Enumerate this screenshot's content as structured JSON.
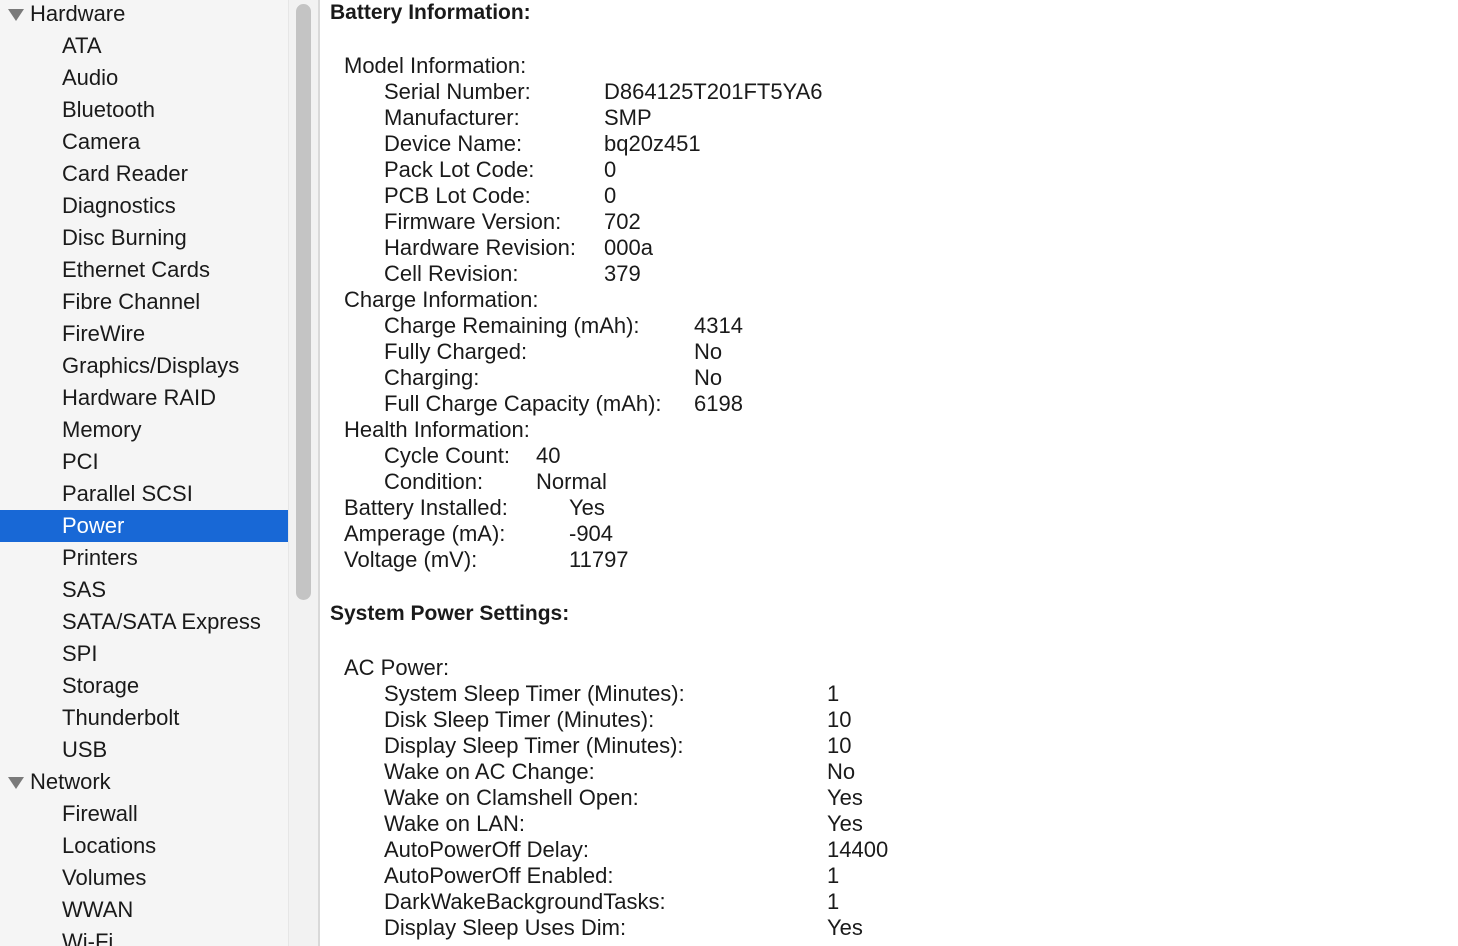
{
  "sidebar": {
    "items": [
      {
        "label": "Hardware",
        "type": "group"
      },
      {
        "label": "ATA",
        "type": "child"
      },
      {
        "label": "Audio",
        "type": "child"
      },
      {
        "label": "Bluetooth",
        "type": "child"
      },
      {
        "label": "Camera",
        "type": "child"
      },
      {
        "label": "Card Reader",
        "type": "child"
      },
      {
        "label": "Diagnostics",
        "type": "child"
      },
      {
        "label": "Disc Burning",
        "type": "child"
      },
      {
        "label": "Ethernet Cards",
        "type": "child"
      },
      {
        "label": "Fibre Channel",
        "type": "child"
      },
      {
        "label": "FireWire",
        "type": "child"
      },
      {
        "label": "Graphics/Displays",
        "type": "child"
      },
      {
        "label": "Hardware RAID",
        "type": "child"
      },
      {
        "label": "Memory",
        "type": "child"
      },
      {
        "label": "PCI",
        "type": "child"
      },
      {
        "label": "Parallel SCSI",
        "type": "child"
      },
      {
        "label": "Power",
        "type": "child",
        "selected": true
      },
      {
        "label": "Printers",
        "type": "child"
      },
      {
        "label": "SAS",
        "type": "child"
      },
      {
        "label": "SATA/SATA Express",
        "type": "child"
      },
      {
        "label": "SPI",
        "type": "child"
      },
      {
        "label": "Storage",
        "type": "child"
      },
      {
        "label": "Thunderbolt",
        "type": "child"
      },
      {
        "label": "USB",
        "type": "child"
      },
      {
        "label": "Network",
        "type": "group"
      },
      {
        "label": "Firewall",
        "type": "child"
      },
      {
        "label": "Locations",
        "type": "child"
      },
      {
        "label": "Volumes",
        "type": "child"
      },
      {
        "label": "WWAN",
        "type": "child"
      },
      {
        "label": "Wi-Fi",
        "type": "child"
      }
    ],
    "selected_color": "#1868d6",
    "disclosure_icon": "triangle-down-icon"
  },
  "battery": {
    "title": "Battery Information:",
    "model": {
      "heading": "Model Information:",
      "rows": [
        {
          "label": "Serial Number:",
          "value": "D864125T201FT5YA6"
        },
        {
          "label": "Manufacturer:",
          "value": "SMP"
        },
        {
          "label": "Device Name:",
          "value": "bq20z451"
        },
        {
          "label": "Pack Lot Code:",
          "value": "0"
        },
        {
          "label": "PCB Lot Code:",
          "value": "0"
        },
        {
          "label": "Firmware Version:",
          "value": "702"
        },
        {
          "label": "Hardware Revision:",
          "value": "000a"
        },
        {
          "label": "Cell Revision:",
          "value": "379"
        }
      ]
    },
    "charge": {
      "heading": "Charge Information:",
      "rows": [
        {
          "label": "Charge Remaining (mAh):",
          "value": "4314"
        },
        {
          "label": "Fully Charged:",
          "value": "No"
        },
        {
          "label": "Charging:",
          "value": "No"
        },
        {
          "label": "Full Charge Capacity (mAh):",
          "value": "6198"
        }
      ]
    },
    "health": {
      "heading": "Health Information:",
      "rows": [
        {
          "label": "Cycle Count:",
          "value": "40"
        },
        {
          "label": "Condition:",
          "value": "Normal"
        }
      ]
    },
    "misc": {
      "rows": [
        {
          "label": "Battery Installed:",
          "value": "Yes"
        },
        {
          "label": "Amperage (mA):",
          "value": "-904"
        },
        {
          "label": "Voltage (mV):",
          "value": "11797"
        }
      ]
    }
  },
  "power": {
    "title": "System Power Settings:",
    "ac": {
      "heading": "AC Power:",
      "rows": [
        {
          "label": "System Sleep Timer (Minutes):",
          "value": "1"
        },
        {
          "label": "Disk Sleep Timer (Minutes):",
          "value": "10"
        },
        {
          "label": "Display Sleep Timer (Minutes):",
          "value": "10"
        },
        {
          "label": "Wake on AC Change:",
          "value": "No"
        },
        {
          "label": "Wake on Clamshell Open:",
          "value": "Yes"
        },
        {
          "label": "Wake on LAN:",
          "value": "Yes"
        },
        {
          "label": "AutoPowerOff Delay:",
          "value": "14400"
        },
        {
          "label": "AutoPowerOff Enabled:",
          "value": "1"
        },
        {
          "label": "DarkWakeBackgroundTasks:",
          "value": "1"
        },
        {
          "label": "Display Sleep Uses Dim:",
          "value": "Yes"
        }
      ]
    }
  }
}
